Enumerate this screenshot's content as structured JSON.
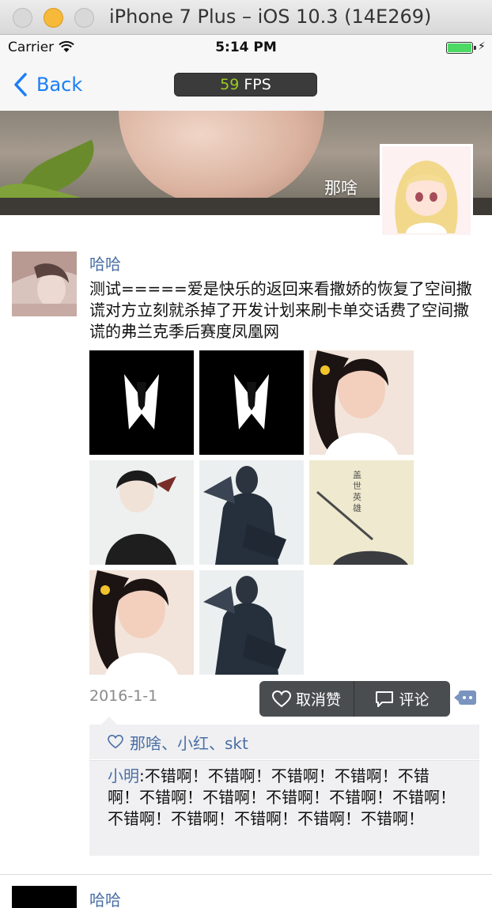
{
  "window": {
    "title": "iPhone 7 Plus – iOS 10.3 (14E269)"
  },
  "status_bar": {
    "carrier": "Carrier",
    "time": "5:14 PM",
    "battery_color": "#4cd964"
  },
  "nav": {
    "back_label": "Back",
    "fps_value": "59",
    "fps_unit": "FPS",
    "accent": "#1a7ef6"
  },
  "header": {
    "name": "那啥"
  },
  "post": {
    "author": "哈哈",
    "text": "测试=====爱是快乐的返回来看撒娇的恢复了空间撒谎对方立刻就杀掉了开发计划来刷卡单交话费了空间撒谎的弗兰克季后赛度凤凰网",
    "images": [
      {
        "icon": "black-suit-illustration"
      },
      {
        "icon": "black-suit-illustration"
      },
      {
        "icon": "smiling-girl-photo"
      },
      {
        "icon": "black-haired-figure-illustration"
      },
      {
        "icon": "masked-figure-with-fan"
      },
      {
        "icon": "sword-and-calligraphy"
      },
      {
        "icon": "smiling-girl-photo"
      },
      {
        "icon": "masked-figure-with-fan"
      }
    ],
    "date": "2016-1-1",
    "actions": {
      "like_label": "取消赞",
      "comment_label": "评论"
    },
    "likes": "那啥、小红、skt",
    "comment": {
      "author": "小明",
      "separator": ":",
      "text": "不错啊！不错啊！不错啊！不错啊！不错啊！不错啊！不错啊！不错啊！不错啊！不错啊！不错啊！不错啊！不错啊！不错啊！不错啊！"
    }
  },
  "next_post": {
    "author": "哈哈"
  },
  "colors": {
    "name_link": "#4a6fa5",
    "fps_green": "#99cc22",
    "popup_bg": "#4a4d50",
    "comment_bg": "#f0f0f2"
  }
}
